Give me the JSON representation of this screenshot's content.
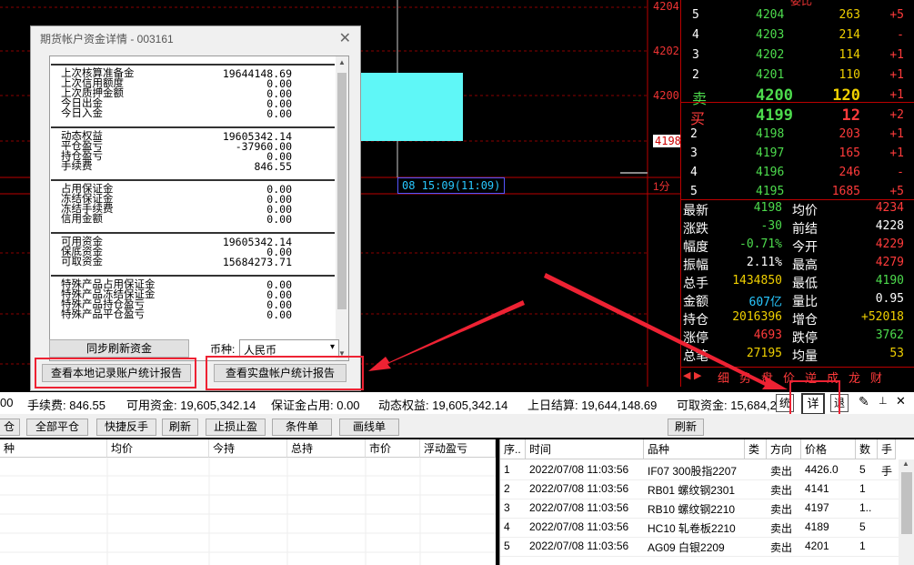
{
  "chart": {
    "axis_labels": [
      "4204",
      "4202",
      "4200",
      "4198"
    ],
    "time_label": "08 15:09(11:09)",
    "period_label": "1分"
  },
  "book": {
    "header_partial": "委比",
    "sells": [
      {
        "label": "5",
        "price": "4204",
        "vol": "263",
        "chg": "+5"
      },
      {
        "label": "4",
        "price": "4203",
        "vol": "214",
        "chg": "-"
      },
      {
        "label": "3",
        "price": "4202",
        "vol": "114",
        "chg": "+1"
      },
      {
        "label": "2",
        "price": "4201",
        "vol": "110",
        "chg": "+1"
      },
      {
        "label": "卖",
        "price": "4200",
        "vol": "120",
        "chg": "+1"
      }
    ],
    "buys": [
      {
        "label": "买",
        "price": "4199",
        "vol": "12",
        "chg": "+2"
      },
      {
        "label": "2",
        "price": "4198",
        "vol": "203",
        "chg": "+1"
      },
      {
        "label": "3",
        "price": "4197",
        "vol": "165",
        "chg": "+1"
      },
      {
        "label": "4",
        "price": "4196",
        "vol": "246",
        "chg": "-"
      },
      {
        "label": "5",
        "price": "4195",
        "vol": "1685",
        "chg": "+5"
      }
    ],
    "quotes": [
      {
        "l1": "最新",
        "v1": "4198",
        "c1": "#4ddb4d",
        "l2": "均价",
        "v2": "4234",
        "c2": "#ff3b3b"
      },
      {
        "l1": "涨跌",
        "v1": "-30",
        "c1": "#4ddb4d",
        "l2": "前结",
        "v2": "4228",
        "c2": "#ffffff"
      },
      {
        "l1": "幅度",
        "v1": "-0.71%",
        "c1": "#4ddb4d",
        "l2": "今开",
        "v2": "4229",
        "c2": "#ff3b3b"
      },
      {
        "l1": "振幅",
        "v1": "2.11%",
        "c1": "#ffffff",
        "l2": "最高",
        "v2": "4279",
        "c2": "#ff3b3b"
      },
      {
        "l1": "总手",
        "v1": "1434850",
        "c1": "#f0d000",
        "l2": "最低",
        "v2": "4190",
        "c2": "#4ddb4d"
      },
      {
        "l1": "金额",
        "v1": "607亿",
        "c1": "#28c8ff",
        "l2": "量比",
        "v2": "0.95",
        "c2": "#ffffff"
      },
      {
        "l1": "持仓",
        "v1": "2016396",
        "c1": "#f0d000",
        "l2": "增仓",
        "v2": "+52018",
        "c2": "#f0d000"
      },
      {
        "l1": "涨停",
        "v1": "4693",
        "c1": "#ff3b3b",
        "l2": "跌停",
        "v2": "3762",
        "c2": "#4ddb4d"
      },
      {
        "l1": "总笔",
        "v1": "27195",
        "c1": "#f0d000",
        "l2": "均量",
        "v2": "53",
        "c2": "#f0d000"
      }
    ],
    "tabs": [
      "细",
      "势",
      "盘",
      "价",
      "逆",
      "成",
      "龙",
      "财"
    ]
  },
  "dialog": {
    "title": "期货帐户资金详情 - 003161",
    "groups": [
      [
        [
          "上次核算准备金",
          "19644148.69"
        ],
        [
          "上次信用额度",
          "0.00"
        ],
        [
          "上次质押金额",
          "0.00"
        ],
        [
          "今日出金",
          "0.00"
        ],
        [
          "今日入金",
          "0.00"
        ]
      ],
      [
        [
          "动态权益",
          "19605342.14"
        ],
        [
          "平仓盈亏",
          "-37960.00"
        ],
        [
          "持仓盈亏",
          "0.00"
        ],
        [
          "手续费",
          "846.55"
        ]
      ],
      [
        [
          "占用保证金",
          "0.00"
        ],
        [
          "冻结保证金",
          "0.00"
        ],
        [
          "冻结手续费",
          "0.00"
        ],
        [
          "信用金额",
          "0.00"
        ]
      ],
      [
        [
          "可用资金",
          "19605342.14"
        ],
        [
          "保底资金",
          "0.00"
        ],
        [
          "可取资金",
          "15684273.71"
        ]
      ],
      [
        [
          "特殊产品占用保证金",
          "0.00"
        ],
        [
          "特殊产品冻结保证金",
          "0.00"
        ],
        [
          "特殊产品持仓盈亏",
          "0.00"
        ],
        [
          "特殊产品平仓盈亏",
          "0.00"
        ]
      ]
    ],
    "sync_button": "同步刷新资金",
    "currency_label": "币种:",
    "currency_value": "人民币",
    "local_report_button": "查看本地记录账户统计报告",
    "real_report_button": "查看实盘帐户统计报告"
  },
  "status": {
    "items": [
      "00",
      "手续费: 846.55",
      "可用资金: 19,605,342.14",
      "保证金占用: 0.00",
      "动态权益: 19,605,342.14",
      "上日结算: 19,644,148.69",
      "可取资金: 15,684,2"
    ],
    "btn_tong": "统",
    "btn_xiang": "详",
    "btn_tui": "退"
  },
  "toolbar": {
    "buttons": [
      "仓",
      "全部平仓",
      "快捷反手",
      "刷新",
      "止损止盈",
      "条件单",
      "画线单"
    ],
    "right_refresh": "刷新"
  },
  "left_table": {
    "headers": [
      "种",
      "均价",
      "今持",
      "总持",
      "市价",
      "浮动盈亏"
    ]
  },
  "right_table": {
    "headers": [
      "序..",
      "时间",
      "品种",
      "类",
      "方向",
      "价格",
      "数",
      "手"
    ],
    "rows": [
      [
        "1",
        "2022/07/08 11:03:56",
        "IF07 300股指2207",
        "",
        "卖出",
        "4426.0",
        "5",
        "手"
      ],
      [
        "2",
        "2022/07/08 11:03:56",
        "RB01 螺纹钢2301",
        "",
        "卖出",
        "4141",
        "1",
        ""
      ],
      [
        "3",
        "2022/07/08 11:03:56",
        "RB10 螺纹钢2210",
        "",
        "卖出",
        "4197",
        "1..",
        ""
      ],
      [
        "4",
        "2022/07/08 11:03:56",
        "HC10 轧卷板2210",
        "",
        "卖出",
        "4189",
        "5",
        ""
      ],
      [
        "5",
        "2022/07/08 11:03:56",
        "AG09 白银2209",
        "",
        "卖出",
        "4201",
        "1",
        ""
      ]
    ]
  }
}
